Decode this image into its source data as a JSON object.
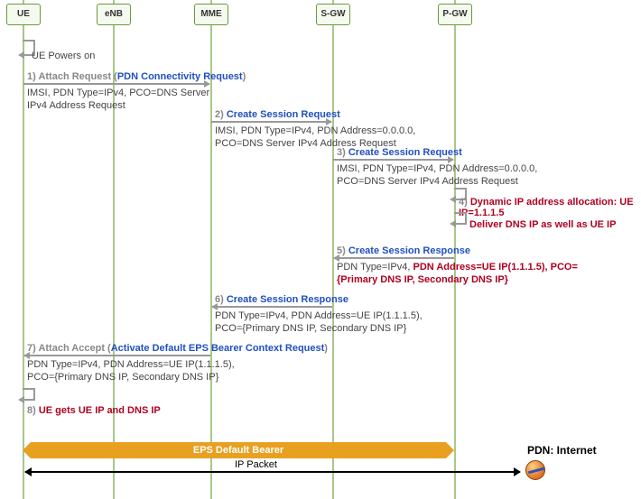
{
  "nodes": {
    "ue": "UE",
    "enb": "eNB",
    "mme": "MME",
    "sgw": "S-GW",
    "pgw": "P-GW"
  },
  "events": {
    "power": "UE Powers on",
    "s1": {
      "step": "1)",
      "text": "Attach Request (",
      "blue": "PDN Connectivity Request",
      "close": ")"
    },
    "d1": "IMSI, PDN Type=IPv4, PCO=DNS Server IPv4 Address Request",
    "s2": {
      "step": "2)",
      "blue": "Create Session Request"
    },
    "d2": "IMSI, PDN Type=IPv4, PDN Address=0.0.0.0, PCO=DNS Server IPv4 Address Request",
    "s3": {
      "step": "3)",
      "blue": "Create Session Request"
    },
    "d3": "IMSI, PDN Type=IPv4, PDN Address=0.0.0.0, PCO=DNS Server IPv4 Address Request",
    "s4": {
      "step": "4)",
      "red": "Dynamic IP address allocation: UE IP=1.1.1.5"
    },
    "s4b": {
      "red": "Deliver DNS IP as well as UE IP"
    },
    "s5": {
      "step": "5)",
      "blue": "Create Session Response"
    },
    "d5a": "PDN Type=IPv4, ",
    "d5b": "PDN Address=UE IP(1.1.1.5), PCO={Primary DNS IP, Secondary DNS IP}",
    "s6": {
      "step": "6)",
      "blue": "Create Session Response"
    },
    "d6": "PDN Type=IPv4, PDN Address=UE IP(1.1.1.5), PCO={Primary DNS IP, Secondary DNS IP}",
    "s7": {
      "step": "7)",
      "text": "Attach Accept (",
      "blue": "Activate Default EPS Bearer Context Request",
      "close": ")"
    },
    "d7": "PDN Type=IPv4, PDN Address=UE IP(1.1.1.5), PCO={Primary DNS IP, Secondary DNS IP}",
    "s8": {
      "step": "8)",
      "red": "UE gets UE IP and DNS IP"
    }
  },
  "bearer": "EPS Default Bearer",
  "packet": "IP Packet",
  "pdn": "PDN: Internet"
}
